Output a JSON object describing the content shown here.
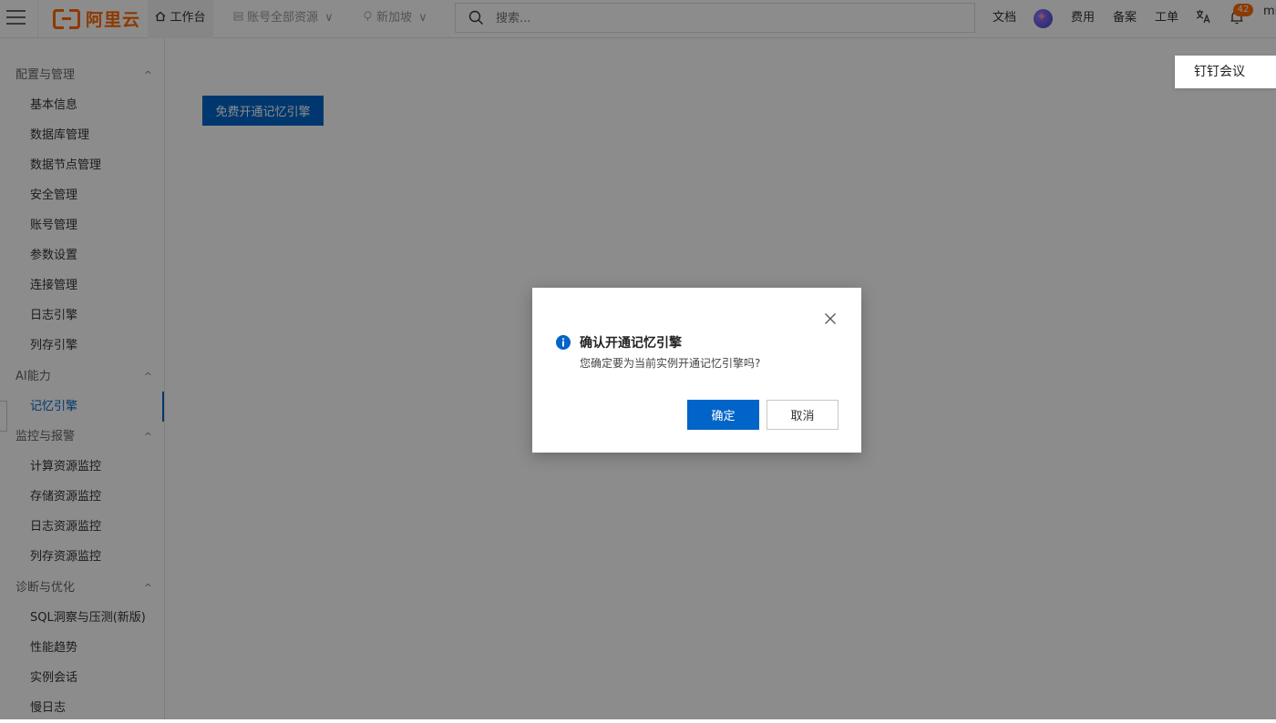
{
  "topbar": {
    "logo_text": "阿里云",
    "workbench_label": "工作台",
    "account_label": "账号全部资源",
    "region_label": "新加坡",
    "search_placeholder": "搜索...",
    "docs_label": "文档",
    "cost_label": "费用",
    "icp_label": "备案",
    "ticket_label": "工单",
    "notification_count": "42",
    "user_clip": "mi"
  },
  "sidebar": {
    "groups": [
      {
        "title": "配置与管理",
        "items": [
          "基本信息",
          "数据库管理",
          "数据节点管理",
          "安全管理",
          "账号管理",
          "参数设置",
          "连接管理",
          "日志引擎",
          "列存引擎"
        ]
      },
      {
        "title": "AI能力",
        "items": [
          "记忆引擎"
        ]
      },
      {
        "title": "监控与报警",
        "items": [
          "计算资源监控",
          "存储资源监控",
          "日志资源监控",
          "列存资源监控"
        ]
      },
      {
        "title": "诊断与优化",
        "items": [
          "SQL洞察与压测(新版)",
          "性能趋势",
          "实例会话",
          "慢日志"
        ]
      }
    ],
    "active_item": "记忆引擎"
  },
  "main": {
    "enable_button": "免费开通记忆引擎",
    "dingtalk_label": "钉钉会议"
  },
  "dialog": {
    "title": "确认开通记忆引擎",
    "message": "您确定要为当前实例开通记忆引擎吗?",
    "ok_label": "确定",
    "cancel_label": "取消"
  },
  "colors": {
    "brand": "#ff6a00",
    "primary": "#0064c8"
  }
}
